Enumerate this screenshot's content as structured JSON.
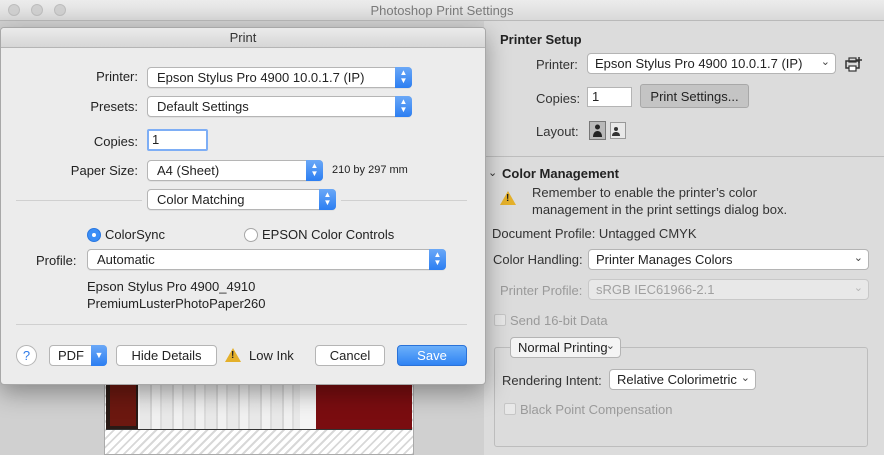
{
  "photoshop": {
    "window_title": "Photoshop Print Settings",
    "printer_setup": {
      "title": "Printer Setup",
      "printer_label": "Printer:",
      "printer_value": "Epson Stylus Pro 4900 10.0.1.7 (IP)",
      "copies_label": "Copies:",
      "copies_value": "1",
      "print_settings_button": "Print Settings...",
      "layout_label": "Layout:"
    },
    "color_management": {
      "title": "Color Management",
      "notice": "Remember to enable the printer’s color management in the print settings dialog box.",
      "notice_line1": "Remember to enable the printer’s color",
      "notice_line2": "management in the print settings dialog box.",
      "document_profile": "Document Profile: Untagged CMYK",
      "color_handling_label": "Color Handling:",
      "color_handling_value": "Printer Manages Colors",
      "printer_profile_label": "Printer Profile:",
      "printer_profile_value": "sRGB IEC61966-2.1",
      "send_16bit_label": "Send 16-bit Data",
      "normal_printing": "Normal Printing",
      "rendering_intent_label": "Rendering Intent:",
      "rendering_intent_value": "Relative Colorimetric",
      "black_point_label": "Black Point Compensation"
    }
  },
  "print_dialog": {
    "title": "Print",
    "printer_label": "Printer:",
    "printer_value": "Epson Stylus Pro 4900 10.0.1.7 (IP)",
    "presets_label": "Presets:",
    "presets_value": "Default Settings",
    "copies_label": "Copies:",
    "copies_value": "1",
    "paper_size_label": "Paper Size:",
    "paper_size_value": "A4 (Sheet)",
    "paper_dimensions": "210 by 297 mm",
    "panel_value": "Color Matching",
    "colorsync_label": "ColorSync",
    "epson_controls_label": "EPSON Color Controls",
    "selected_option": "ColorSync",
    "profile_label": "Profile:",
    "profile_value": "Automatic",
    "profile_desc_line1": "Epson Stylus Pro 4900_4910",
    "profile_desc_line2": "PremiumLusterPhotoPaper260",
    "help_label": "?",
    "pdf_label": "PDF",
    "hide_details_label": "Hide Details",
    "low_ink_label": "Low Ink",
    "cancel_label": "Cancel",
    "save_label": "Save"
  },
  "icons": {
    "add_printer": "printer-add-icon",
    "layout_portrait": "portrait-layout-icon",
    "layout_landscape": "landscape-layout-icon",
    "warning": "warning-icon",
    "chevron": "chevron-down-icon",
    "stepper": "stepper-icon"
  },
  "colors": {
    "accent": "#2f83f3",
    "warning": "#e4b02a"
  }
}
